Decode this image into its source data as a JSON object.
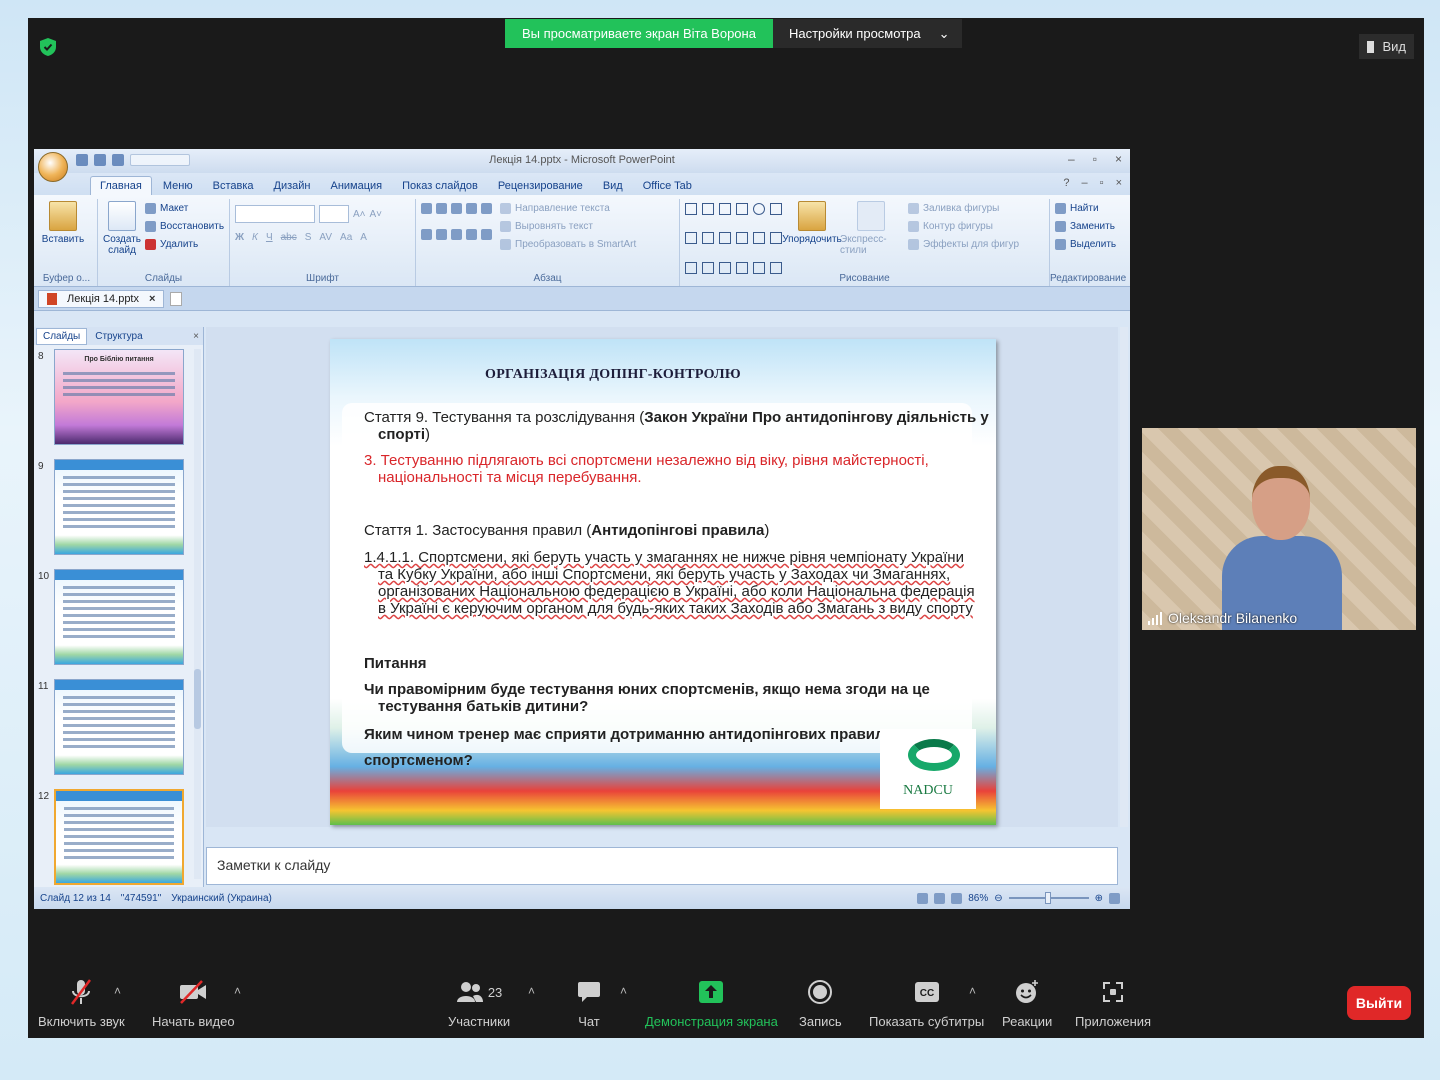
{
  "zoom": {
    "share_banner": "Вы просматриваете экран Віта Ворона",
    "view_options": "Настройки просмотра",
    "view_button": "Вид",
    "participant_name": "Oleksandr Bilanenko",
    "participants_count": "23",
    "toolbar": {
      "mute": "Включить звук",
      "video": "Начать видео",
      "participants": "Участники",
      "chat": "Чат",
      "share": "Демонстрация экрана",
      "record": "Запись",
      "captions": "Показать субтитры",
      "reactions": "Реакции",
      "apps": "Приложения",
      "leave": "Выйти"
    },
    "colors": {
      "share_green": "#22c25a",
      "leave_red": "#e02828"
    }
  },
  "ppt": {
    "window_title": "Лекція 14.pptx - Microsoft PowerPoint",
    "tabs": [
      "Главная",
      "Меню",
      "Вставка",
      "Дизайн",
      "Анимация",
      "Показ слайдов",
      "Рецензирование",
      "Вид",
      "Office Tab"
    ],
    "ribbon": {
      "paste": "Вставить",
      "clipboard": "Буфер о...",
      "new_slide": "Создать слайд",
      "layout": "Макет",
      "reset": "Восстановить",
      "delete": "Удалить",
      "slides_group": "Слайды",
      "font_group": "Шрифт",
      "text_direction": "Направление текста",
      "align_text": "Выровнять текст",
      "smartart": "Преобразовать в SmartArt",
      "paragraph_group": "Абзац",
      "arrange": "Упорядочить",
      "quick_styles": "Экспресс-стили",
      "shape_fill": "Заливка фигуры",
      "shape_outline": "Контур фигуры",
      "shape_effects": "Эффекты для фигур",
      "drawing_group": "Рисование",
      "find": "Найти",
      "replace": "Заменить",
      "select": "Выделить",
      "editing_group": "Редактирование"
    },
    "doc_tab": "Лекція 14.pptx",
    "panel_tabs": {
      "slides": "Слайды",
      "outline": "Структура"
    },
    "thumbnails": [
      {
        "num": "8",
        "title": "Про Біблію питання"
      },
      {
        "num": "9",
        "title": ""
      },
      {
        "num": "10",
        "title": ""
      },
      {
        "num": "11",
        "title": ""
      },
      {
        "num": "12",
        "title": ""
      }
    ],
    "slide": {
      "title": "ОРГАНІЗАЦІЯ ДОПІНГ-КОНТРОЛЮ",
      "l1a": "Стаття 9. Тестування та розслідування (",
      "l1b": "Закон України Про антидопінгову діяльність у",
      "l1c": "спорті",
      "l1d": ")",
      "l2a": "3. Тестуванню підлягають всі спортсмени незалежно від віку, рівня майстерності,",
      "l2b": "національності та місця перебування.",
      "l3a": "Стаття 1. Застосування правил (",
      "l3b": "Антидопінгові правила",
      "l3c": ")",
      "l4a": "1.4.1.1. Спортсмени, які беруть участь у змаганнях не нижче рівня чемпіонату України",
      "l4b": "та Кубку України, або інші Спортсмени, які беруть участь у Заходах чи Змаганнях,",
      "l4c": "організованих Національною федерацією в Україні, або коли Національна федерація",
      "l4d": "в Україні є керуючим органом для будь-яких таких Заходів або Змагань з виду спорту",
      "q_head": "Питання",
      "q1a": "Чи правомірним буде тестування юних спортсменів, якщо нема згоди на це",
      "q1b": "тестування батьків дитини?",
      "q2a": "Яким чином тренер має сприяти дотриманню антидопінгових правил",
      "q2b": "спортсменом?",
      "logo_text": "NADCU"
    },
    "notes_placeholder": "Заметки к слайду",
    "status": {
      "slide_pos": "Слайд 12 из 14",
      "theme": "\"474591\"",
      "language": "Украинский (Украина)",
      "zoom": "86%"
    }
  }
}
